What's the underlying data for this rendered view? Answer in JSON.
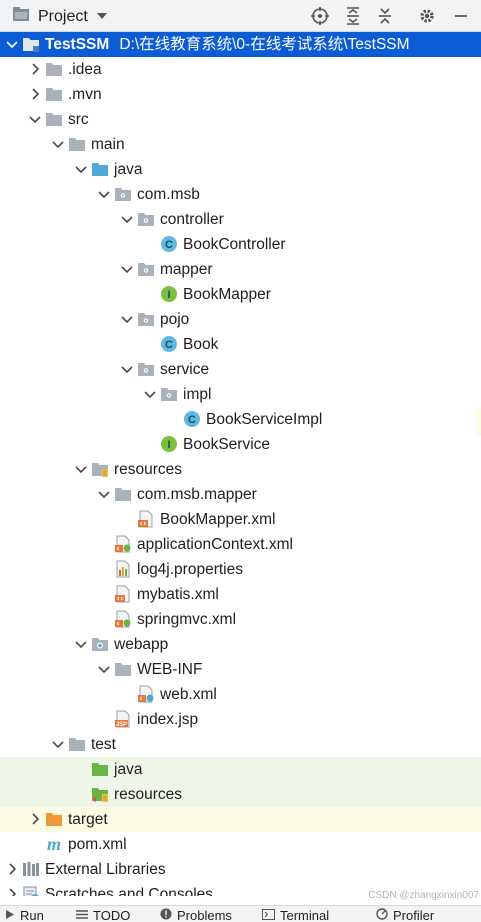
{
  "toolbar": {
    "title": "Project",
    "icons": [
      "locate-icon",
      "expand-all-icon",
      "collapse-all-icon",
      "gear-icon",
      "minimize-icon"
    ]
  },
  "tree": [
    {
      "label": "TestSSM",
      "path": "D:\\在线教育系统\\0-在线考试系统\\TestSSM",
      "depth": 0,
      "expanded": true,
      "icon": "module-folder-icon",
      "selected": true
    },
    {
      "label": ".idea",
      "depth": 1,
      "expanded": false,
      "icon": "folder-icon"
    },
    {
      "label": ".mvn",
      "depth": 1,
      "expanded": false,
      "icon": "folder-icon"
    },
    {
      "label": "src",
      "depth": 1,
      "expanded": true,
      "icon": "folder-icon"
    },
    {
      "label": "main",
      "depth": 2,
      "expanded": true,
      "icon": "folder-icon"
    },
    {
      "label": "java",
      "depth": 3,
      "expanded": true,
      "icon": "source-folder-icon"
    },
    {
      "label": "com.msb",
      "depth": 4,
      "expanded": true,
      "icon": "package-icon"
    },
    {
      "label": "controller",
      "depth": 5,
      "expanded": true,
      "icon": "package-icon"
    },
    {
      "label": "BookController",
      "depth": 6,
      "icon": "class-icon"
    },
    {
      "label": "mapper",
      "depth": 5,
      "expanded": true,
      "icon": "package-icon"
    },
    {
      "label": "BookMapper",
      "depth": 6,
      "icon": "interface-icon"
    },
    {
      "label": "pojo",
      "depth": 5,
      "expanded": true,
      "icon": "package-icon"
    },
    {
      "label": "Book",
      "depth": 6,
      "icon": "class-icon"
    },
    {
      "label": "service",
      "depth": 5,
      "expanded": true,
      "icon": "package-icon"
    },
    {
      "label": "impl",
      "depth": 6,
      "expanded": true,
      "icon": "package-icon"
    },
    {
      "label": "BookServiceImpl",
      "depth": 7,
      "icon": "class-icon"
    },
    {
      "label": "BookService",
      "depth": 6,
      "icon": "interface-icon"
    },
    {
      "label": "resources",
      "depth": 3,
      "expanded": true,
      "icon": "resources-folder-icon"
    },
    {
      "label": "com.msb.mapper",
      "depth": 4,
      "expanded": true,
      "icon": "folder-icon"
    },
    {
      "label": "BookMapper.xml",
      "depth": 5,
      "icon": "xml-file-icon"
    },
    {
      "label": "applicationContext.xml",
      "depth": 4,
      "icon": "spring-xml-icon"
    },
    {
      "label": "log4j.properties",
      "depth": 4,
      "icon": "properties-file-icon"
    },
    {
      "label": "mybatis.xml",
      "depth": 4,
      "icon": "xml-file-icon"
    },
    {
      "label": "springmvc.xml",
      "depth": 4,
      "icon": "spring-xml-icon"
    },
    {
      "label": "webapp",
      "depth": 3,
      "expanded": true,
      "icon": "web-folder-icon"
    },
    {
      "label": "WEB-INF",
      "depth": 4,
      "expanded": true,
      "icon": "folder-icon"
    },
    {
      "label": "web.xml",
      "depth": 5,
      "icon": "web-xml-icon"
    },
    {
      "label": "index.jsp",
      "depth": 4,
      "icon": "jsp-file-icon"
    },
    {
      "label": "test",
      "depth": 2,
      "expanded": true,
      "icon": "folder-icon"
    },
    {
      "label": "java",
      "depth": 3,
      "icon": "test-folder-icon",
      "highlight": "green"
    },
    {
      "label": "resources",
      "depth": 3,
      "icon": "test-resources-icon",
      "highlight": "green"
    },
    {
      "label": "target",
      "depth": 1,
      "expanded": false,
      "icon": "excluded-folder-icon",
      "highlight": "yellow"
    },
    {
      "label": "pom.xml",
      "depth": 1,
      "icon": "maven-file-icon"
    },
    {
      "label": "External Libraries",
      "depth": 0,
      "expanded": false,
      "icon": "libraries-icon"
    },
    {
      "label": "Scratches and Consoles",
      "depth": 0,
      "expanded": false,
      "icon": "scratches-icon"
    }
  ],
  "bottombar": {
    "items": [
      {
        "label": "Run",
        "icon": "run-icon"
      },
      {
        "label": "TODO",
        "icon": "todo-icon"
      },
      {
        "label": "Problems",
        "icon": "problems-icon"
      },
      {
        "label": "Terminal",
        "icon": "terminal-icon"
      },
      {
        "label": "Profiler",
        "icon": "profiler-icon"
      }
    ]
  },
  "watermark": "CSDN @zhangxinxin007",
  "colors": {
    "selection": "#0b5cd5",
    "folder": "#a9b1bb",
    "source_folder": "#4fa8d6",
    "class_icon": "#5fb8e0",
    "interface_icon": "#7bbf3e",
    "xml_orange": "#e8763b",
    "test_green": "#6bb344",
    "excluded_orange": "#ef9a3a"
  }
}
